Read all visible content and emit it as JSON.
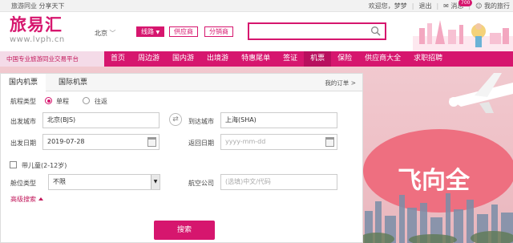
{
  "topbar": {
    "slogan": "旅游同业 分享天下",
    "greeting": "欢迎您，梦梦",
    "logout": "退出",
    "message_label": "消息",
    "message_count": "700",
    "my_label": "我的旅行"
  },
  "header": {
    "logo_mark": "旅易汇",
    "logo_url": "www.lvph.cn",
    "city": "北京",
    "pills": [
      "线路",
      "供应商",
      "分销商"
    ],
    "search_placeholder": ""
  },
  "nav": {
    "tagline": "中国专业旅游同业交易平台",
    "items": [
      "首页",
      "周边游",
      "国内游",
      "出境游",
      "特惠尾单",
      "签证",
      "机票",
      "保险",
      "供应商大全",
      "求职招聘"
    ],
    "current_index": 6
  },
  "hero": {
    "slogan_partial": "飞向全"
  },
  "booking": {
    "tabs": [
      "国内机票",
      "国际机票"
    ],
    "active_tab": 0,
    "my_orders": "我的订单",
    "trip_type_label": "航程类型",
    "trip_types": [
      "单程",
      "往返"
    ],
    "selected_trip_type": 0,
    "from_label": "出发城市",
    "from_value": "北京(BJS)",
    "to_label": "到达城市",
    "to_value": "上海(SHA)",
    "depart_label": "出发日期",
    "depart_value": "2019-07-28",
    "return_label": "返回日期",
    "return_placeholder": "yyyy-mm-dd",
    "child_label": "带儿童(2-12岁)",
    "child_checked": false,
    "cabin_label": "舱位类型",
    "cabin_value": "不限",
    "airline_label": "航空公司",
    "airline_placeholder": "(选填)中文/代码",
    "advanced_label": "高级搜索",
    "search_button": "搜索"
  },
  "colors": {
    "brand": "#d6166e",
    "hero_bg": "#eec0c6"
  }
}
